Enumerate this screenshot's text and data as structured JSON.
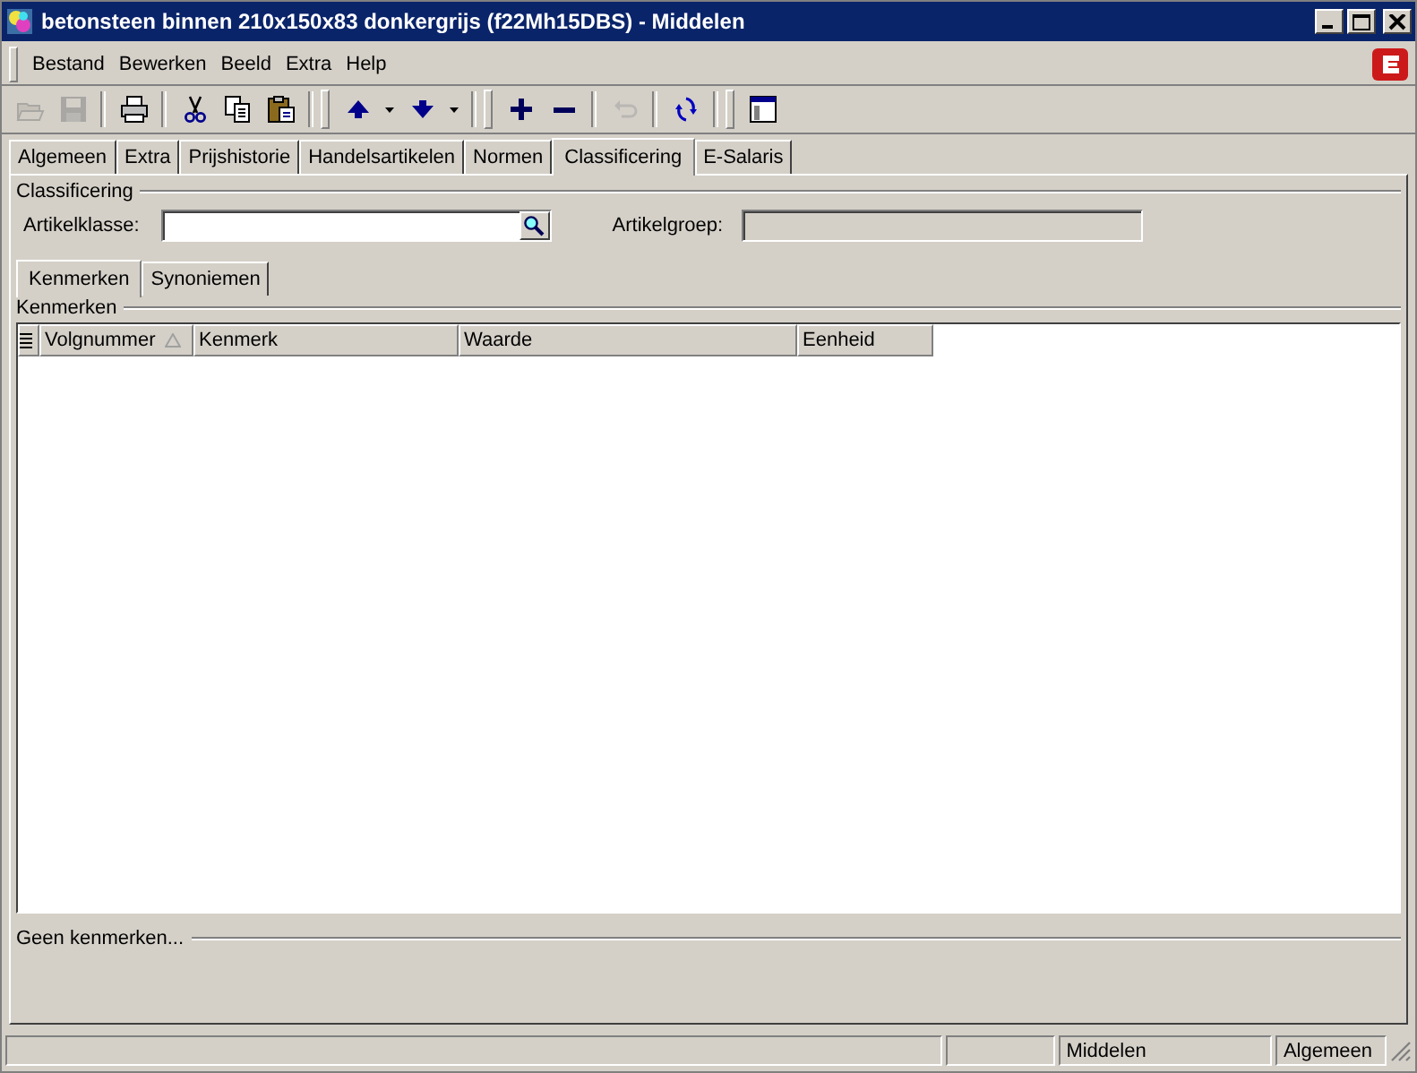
{
  "window": {
    "title": "betonsteen binnen 210x150x83 donkergrijs (f22Mh15DBS) - Middelen"
  },
  "menu": [
    "Bestand",
    "Bewerken",
    "Beeld",
    "Extra",
    "Help"
  ],
  "toolbar": [
    {
      "kind": "open",
      "disabled": true
    },
    {
      "kind": "save",
      "disabled": true
    },
    {
      "kind": "sep"
    },
    {
      "kind": "print",
      "disabled": false
    },
    {
      "kind": "sep"
    },
    {
      "kind": "cut",
      "disabled": false
    },
    {
      "kind": "copy",
      "disabled": false
    },
    {
      "kind": "paste",
      "disabled": false
    },
    {
      "kind": "grip"
    },
    {
      "kind": "up",
      "disabled": false
    },
    {
      "kind": "drop",
      "disabled": false
    },
    {
      "kind": "down",
      "disabled": false
    },
    {
      "kind": "drop",
      "disabled": false
    },
    {
      "kind": "grip"
    },
    {
      "kind": "add",
      "disabled": false
    },
    {
      "kind": "remove",
      "disabled": false
    },
    {
      "kind": "sep"
    },
    {
      "kind": "undo",
      "disabled": true
    },
    {
      "kind": "sep"
    },
    {
      "kind": "refresh",
      "disabled": false
    },
    {
      "kind": "grip"
    },
    {
      "kind": "layout",
      "disabled": false
    }
  ],
  "tabs": [
    {
      "label": "Algemeen",
      "selected": false
    },
    {
      "label": "Extra",
      "selected": false
    },
    {
      "label": "Prijshistorie",
      "selected": false
    },
    {
      "label": "Handelsartikelen",
      "selected": false
    },
    {
      "label": "Normen",
      "selected": false
    },
    {
      "label": "Classificering",
      "selected": true
    },
    {
      "label": "E-Salaris",
      "selected": false
    }
  ],
  "classification": {
    "heading": "Classificering",
    "class_label": "Artikelklasse:",
    "group_label": "Artikelgroep:"
  },
  "subtabs": [
    {
      "label": "Kenmerken",
      "selected": true
    },
    {
      "label": "Synoniemen",
      "selected": false
    }
  ],
  "grid": {
    "heading": "Kenmerken",
    "columns": [
      {
        "label": "Volgnummer",
        "sorted": true
      },
      {
        "label": "Kenmerk",
        "sorted": false
      },
      {
        "label": "Waarde",
        "sorted": false
      },
      {
        "label": "Eenheid",
        "sorted": false
      }
    ],
    "footer": "Geen kenmerken..."
  },
  "status_bar": [
    "Middelen",
    "Algemeen"
  ]
}
